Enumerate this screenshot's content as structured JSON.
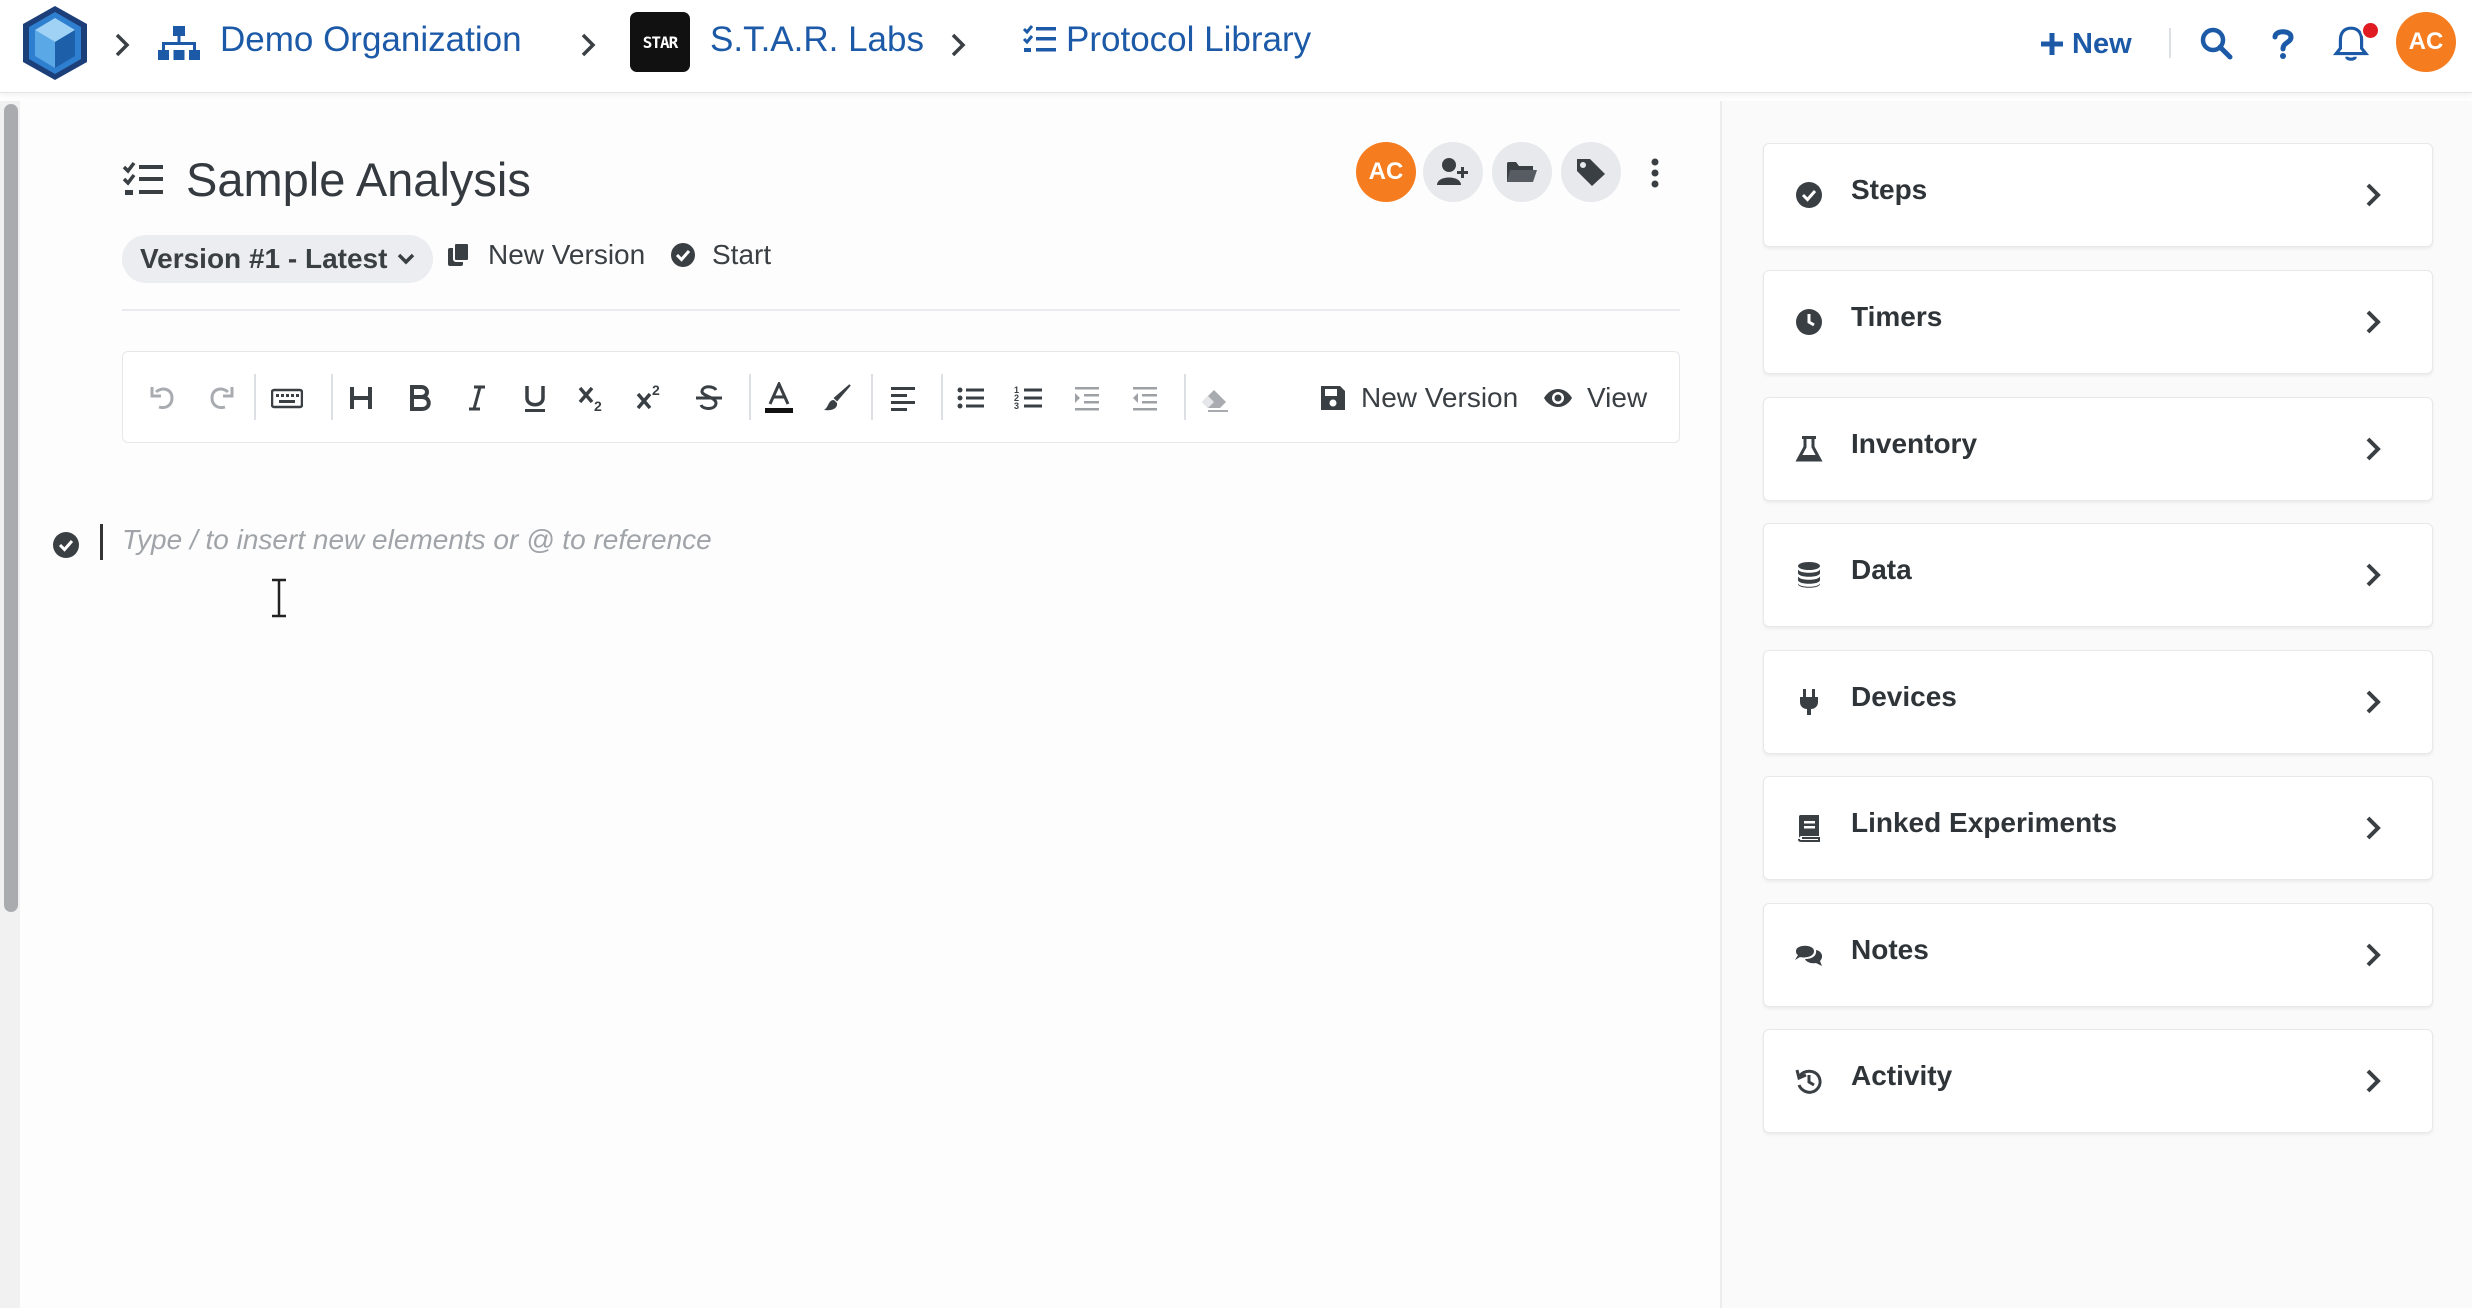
{
  "nav": {
    "breadcrumbs": [
      "Demo Organization",
      "S.T.A.R. Labs",
      "Protocol Library"
    ],
    "star_logo_text": "STAR",
    "new_label": "New",
    "user_initials": "AC",
    "colors": {
      "brand": "#1c5aa8",
      "avatar": "#f57c1f",
      "notification": "#e01b22"
    }
  },
  "document": {
    "title": "Sample Analysis",
    "version": "Version #1 - Latest",
    "new_version_label": "New Version",
    "start_label": "Start",
    "owner_initials": "AC",
    "actions": [
      "add-user-icon",
      "folder-icon",
      "tag-icon",
      "kebab-icon"
    ]
  },
  "toolbar": {
    "buttons": [
      "undo",
      "redo",
      "keyboard",
      "heading",
      "bold",
      "italic",
      "underline",
      "subscript",
      "superscript",
      "strikethrough",
      "text-color",
      "highlight",
      "align-left",
      "bullet-list",
      "numbered-list",
      "indent",
      "outdent",
      "clear-format"
    ],
    "save_label": "New Version",
    "view_label": "View"
  },
  "editor": {
    "placeholder": "Type / to insert new elements or @ to reference"
  },
  "sidebar": {
    "panels": [
      {
        "label": "Steps",
        "icon": "check-circle-icon"
      },
      {
        "label": "Timers",
        "icon": "clock-icon"
      },
      {
        "label": "Inventory",
        "icon": "flask-icon"
      },
      {
        "label": "Data",
        "icon": "database-icon"
      },
      {
        "label": "Devices",
        "icon": "plug-icon"
      },
      {
        "label": "Linked Experiments",
        "icon": "book-icon"
      },
      {
        "label": "Notes",
        "icon": "comments-icon"
      },
      {
        "label": "Activity",
        "icon": "history-icon"
      }
    ]
  }
}
